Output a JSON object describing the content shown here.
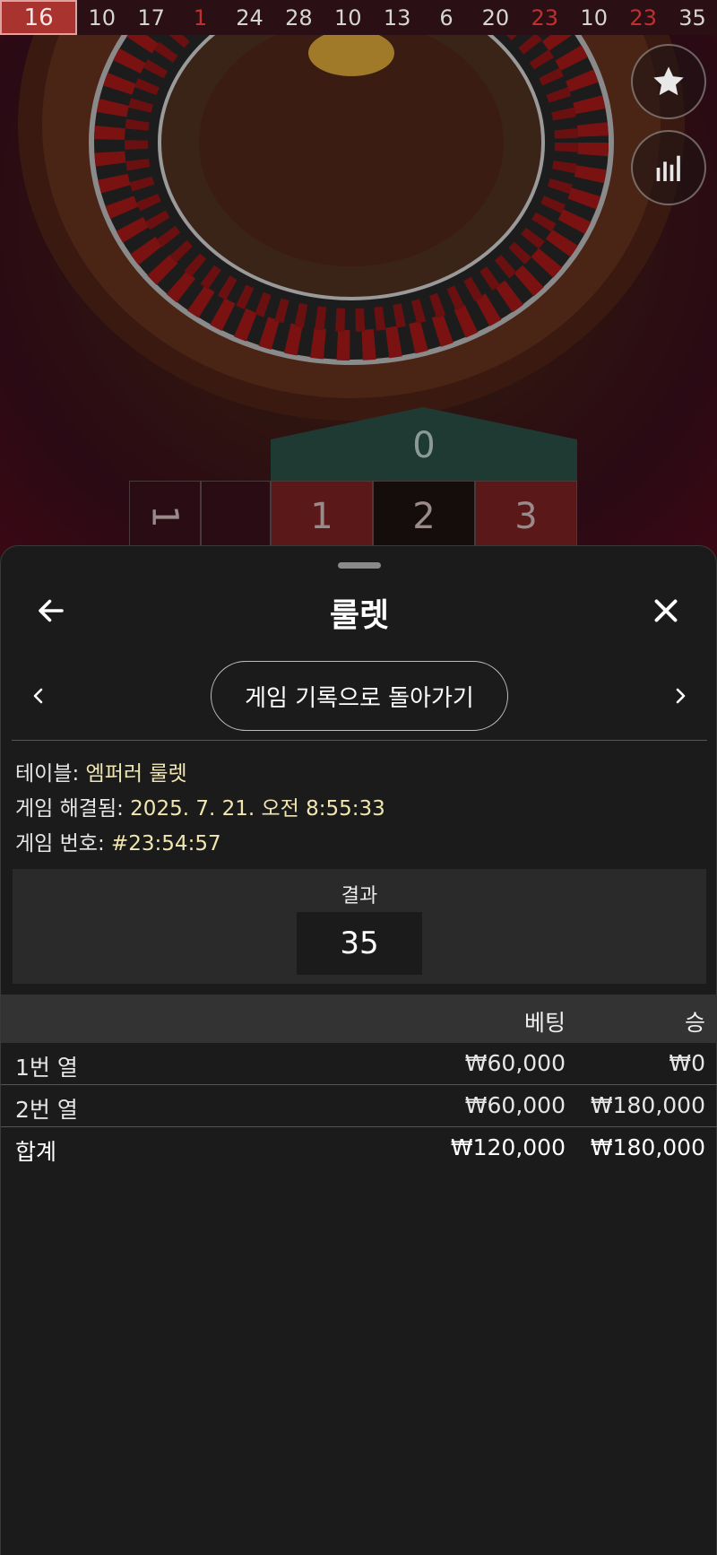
{
  "history": [
    {
      "value": "16",
      "color": "red",
      "latest": true
    },
    {
      "value": "10",
      "color": "black"
    },
    {
      "value": "17",
      "color": "black"
    },
    {
      "value": "1",
      "color": "red"
    },
    {
      "value": "24",
      "color": "black"
    },
    {
      "value": "28",
      "color": "black"
    },
    {
      "value": "10",
      "color": "black"
    },
    {
      "value": "13",
      "color": "black"
    },
    {
      "value": "6",
      "color": "black"
    },
    {
      "value": "20",
      "color": "black"
    },
    {
      "value": "23",
      "color": "red"
    },
    {
      "value": "10",
      "color": "black"
    },
    {
      "value": "23",
      "color": "red"
    },
    {
      "value": "35",
      "color": "black"
    }
  ],
  "stream": {
    "favorite_icon": "star-icon",
    "stats_icon": "bar-chart-icon",
    "grid": {
      "zero": "0",
      "col_cells": [
        "1",
        "2",
        "3"
      ],
      "partial": "1"
    }
  },
  "sheet": {
    "title": "룰렛",
    "back_icon": "arrow-left-icon",
    "close_icon": "close-icon",
    "prev_icon": "chevron-left-icon",
    "next_icon": "chevron-right-icon",
    "back_to_history": "게임 기록으로 돌아가기",
    "info": {
      "table_label": "테이블: ",
      "table_value": "엠퍼러 룰렛",
      "resolved_label": "게임 해결됨: ",
      "resolved_value": "2025. 7. 21. 오전 8:55:33",
      "number_label": "게임 번호: ",
      "number_value": "#23:54:57"
    },
    "result": {
      "label": "결과",
      "value": "35"
    },
    "bets_table": {
      "headers": {
        "bet": "베팅",
        "win": "승"
      },
      "rows": [
        {
          "name": "1번 열",
          "bet": "₩60,000",
          "win": "₩0"
        },
        {
          "name": "2번 열",
          "bet": "₩60,000",
          "win": "₩180,000"
        }
      ],
      "total": {
        "name": "합계",
        "bet": "₩120,000",
        "win": "₩180,000"
      }
    }
  },
  "colors": {
    "red": "#c0302c",
    "accent_value": "#f2e6b0",
    "sheet_bg": "#1b1b1b"
  }
}
